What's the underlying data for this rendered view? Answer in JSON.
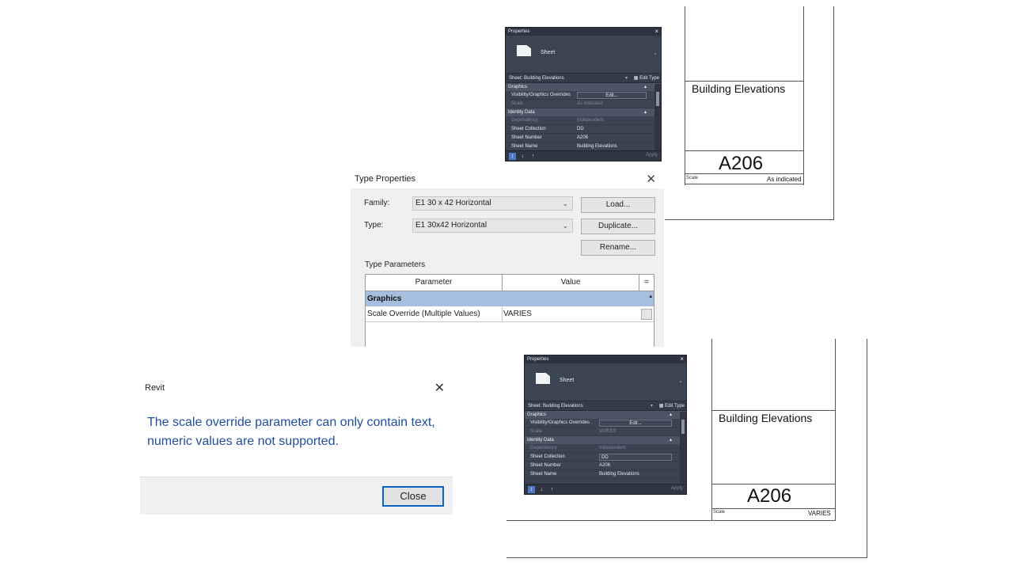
{
  "top_sheet": {
    "title": "Building Elevations",
    "number": "A206",
    "scale_label": "Scale",
    "scale_value": "As indicated"
  },
  "top_props": {
    "palette_title": "Properties",
    "type_name": "Sheet",
    "filter_label": "Sheet: Building Elevations",
    "edit_type": "Edit Type",
    "categories": [
      "Graphics",
      "Identity Data"
    ],
    "rows": [
      {
        "key": "Visibility/Graphics Overrides",
        "value": "Edit..."
      },
      {
        "key": "Scale",
        "value": "As indicated"
      },
      {
        "key": "Dependency",
        "value": "Independent"
      },
      {
        "key": "Sheet Collection",
        "value": "DD"
      },
      {
        "key": "Sheet Number",
        "value": "A206"
      },
      {
        "key": "Sheet Name",
        "value": "Building Elevations"
      }
    ],
    "apply": "Apply"
  },
  "type_properties": {
    "title": "Type Properties",
    "family_label": "Family:",
    "family_value": "E1 30 x 42 Horizontal",
    "type_label": "Type:",
    "type_value": "E1 30x42 Horizontal",
    "load_button": "Load...",
    "duplicate_button": "Duplicate...",
    "rename_button": "Rename...",
    "params_label": "Type Parameters",
    "col_parameter": "Parameter",
    "col_value": "Value",
    "col_extra": "=",
    "group": "Graphics",
    "row_key": "Scale Override (Multiple Values)",
    "row_value": "VARIES"
  },
  "message": {
    "title": "Revit",
    "text": "The scale override parameter can only contain text, numeric values are not supported.",
    "close_button": "Close"
  },
  "bottom_props": {
    "palette_title": "Properties",
    "type_name": "Sheet",
    "filter_label": "Sheet: Building Elevations",
    "edit_type": "Edit Type",
    "categories": [
      "Graphics",
      "Identity Data"
    ],
    "rows": [
      {
        "key": "Visibility/Graphics Overrides",
        "value": "Edit..."
      },
      {
        "key": "Scale",
        "value": "VARIES"
      },
      {
        "key": "Dependency",
        "value": "Independent"
      },
      {
        "key": "Sheet Collection",
        "value": "DD"
      },
      {
        "key": "Sheet Number",
        "value": "A206"
      },
      {
        "key": "Sheet Name",
        "value": "Building Elevations"
      }
    ],
    "apply": "Apply"
  },
  "bottom_sheet": {
    "title": "Building Elevations",
    "number": "A206",
    "scale_label": "Scale",
    "scale_value": "VARIES"
  }
}
